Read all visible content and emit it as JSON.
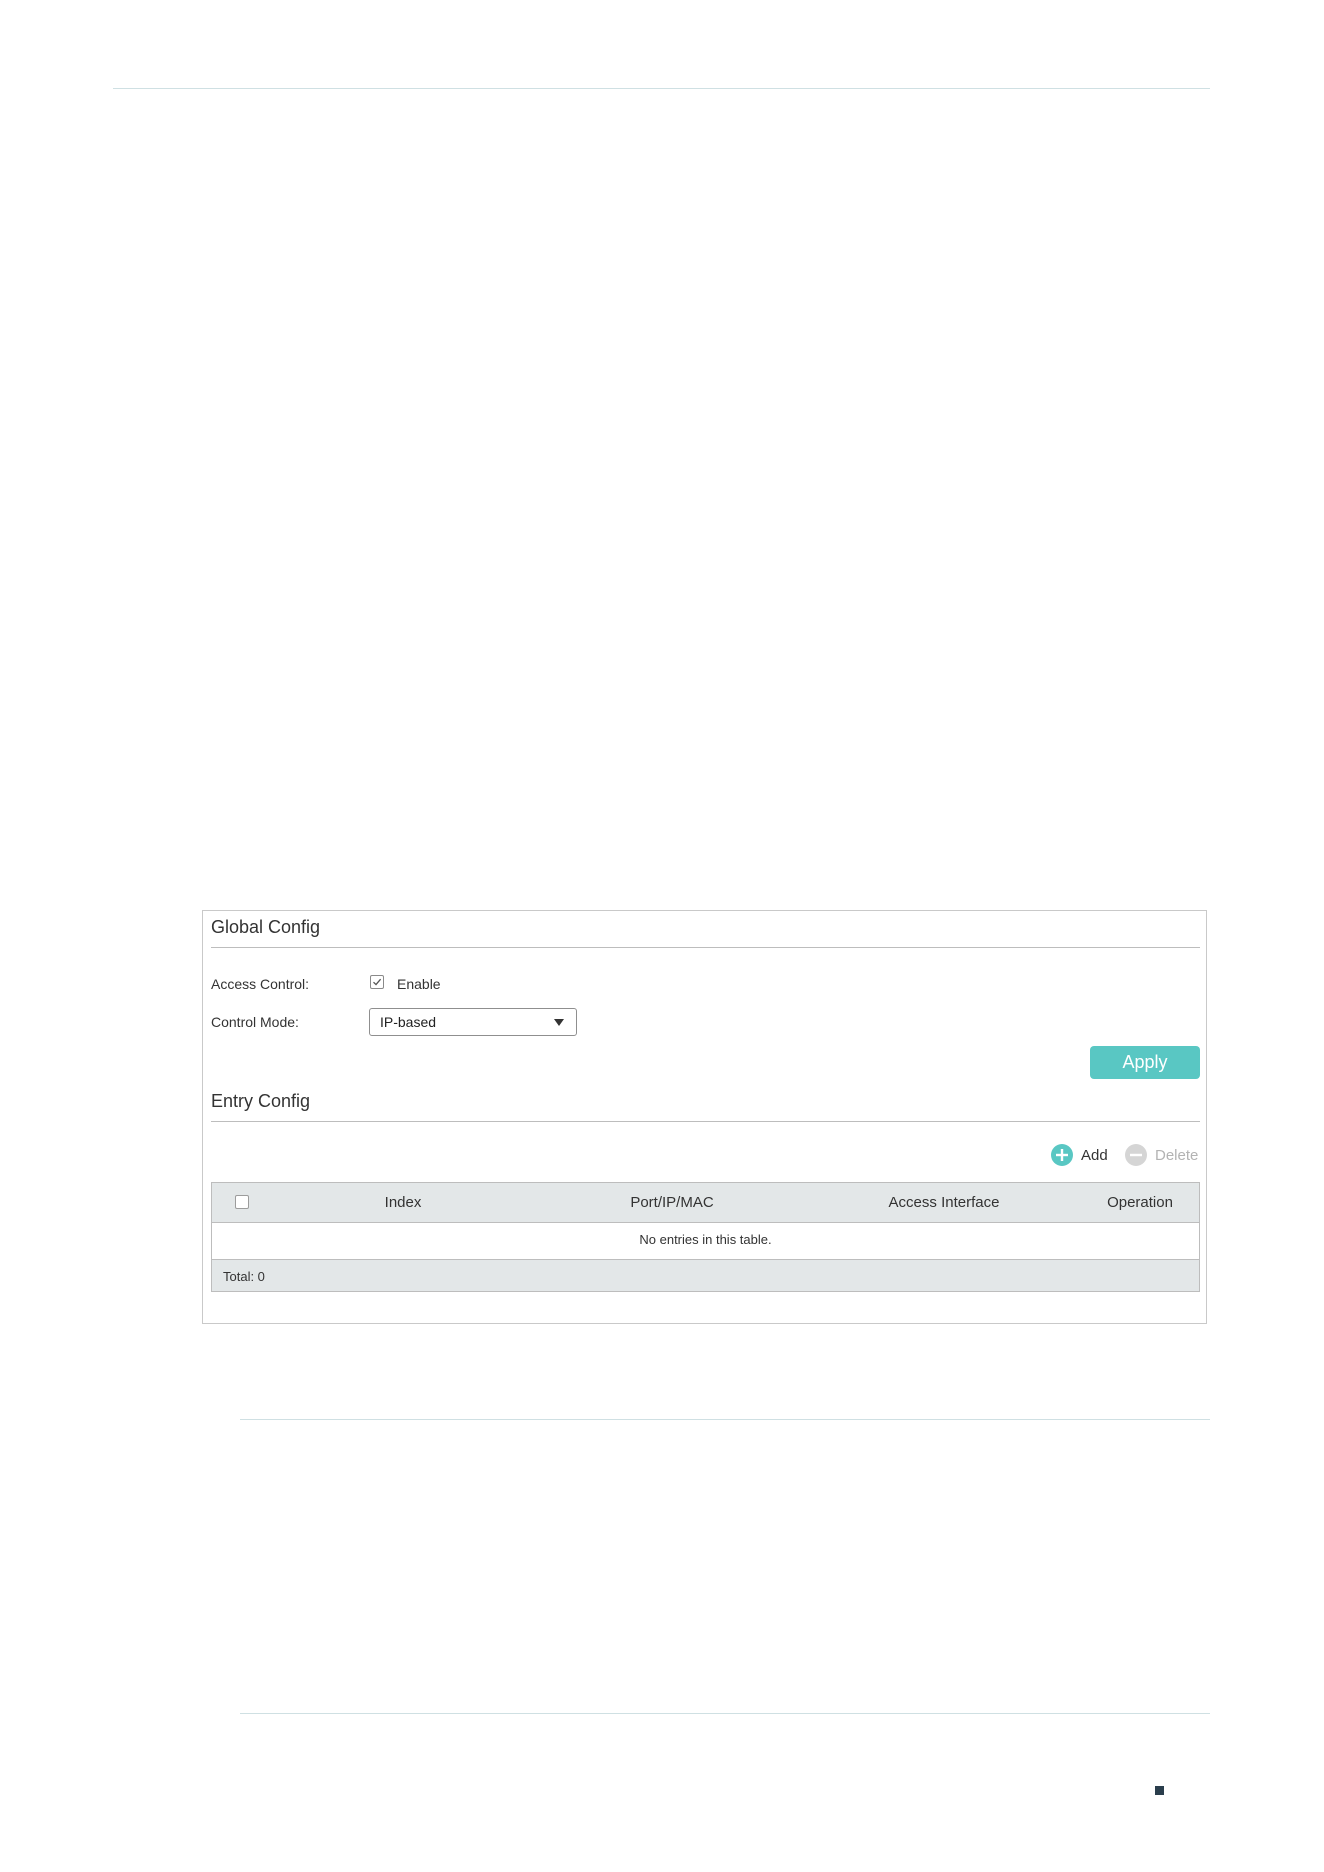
{
  "global_config": {
    "title": "Global Config",
    "access_control_label": "Access Control:",
    "access_control_checked": true,
    "enable_label": "Enable",
    "control_mode_label": "Control Mode:",
    "control_mode_value": "IP-based",
    "apply_label": "Apply"
  },
  "entry_config": {
    "title": "Entry Config",
    "add_label": "Add",
    "delete_label": "Delete",
    "table": {
      "columns": [
        "Index",
        "Port/IP/MAC",
        "Access Interface",
        "Operation"
      ],
      "rows": [],
      "empty_message": "No entries in this table.",
      "total": "Total: 0"
    }
  },
  "colors": {
    "accent": "#59c7c3",
    "table_header_bg": "#e3e7e8",
    "disabled_text": "#b3b3b3",
    "page_marker": "#2a3e4c"
  },
  "icons": {
    "add": "plus-circle-icon",
    "delete": "minus-circle-icon",
    "checkbox": "checkmark-icon",
    "select": "caret-down-icon"
  }
}
